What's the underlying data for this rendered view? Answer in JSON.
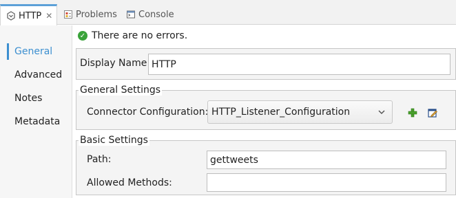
{
  "tabs": [
    {
      "label": "HTTP",
      "icon": "http-connector-icon",
      "active": true,
      "closable": true
    },
    {
      "label": "Problems",
      "icon": "problems-icon",
      "active": false
    },
    {
      "label": "Console",
      "icon": "console-icon",
      "active": false
    }
  ],
  "nav": {
    "items": [
      {
        "label": "General",
        "active": true
      },
      {
        "label": "Advanced",
        "active": false
      },
      {
        "label": "Notes",
        "active": false
      },
      {
        "label": "Metadata",
        "active": false
      }
    ]
  },
  "status": {
    "text": "There are no errors.",
    "icon": "success-check-icon"
  },
  "display_name": {
    "label": "Display Name:",
    "value": "HTTP"
  },
  "general_settings": {
    "title": "General Settings",
    "connector_label": "Connector Configuration:",
    "connector_value": "HTTP_Listener_Configuration",
    "add_icon": "add-plus-icon",
    "edit_icon": "edit-icon"
  },
  "basic_settings": {
    "title": "Basic Settings",
    "path_label": "Path:",
    "path_value": "gettweets",
    "methods_label": "Allowed Methods:",
    "methods_value": ""
  },
  "colors": {
    "accent": "#3c8fd0",
    "tab_highlight": "#5ca0d8",
    "success": "#3aa33a",
    "add_green": "#4aa02c"
  }
}
